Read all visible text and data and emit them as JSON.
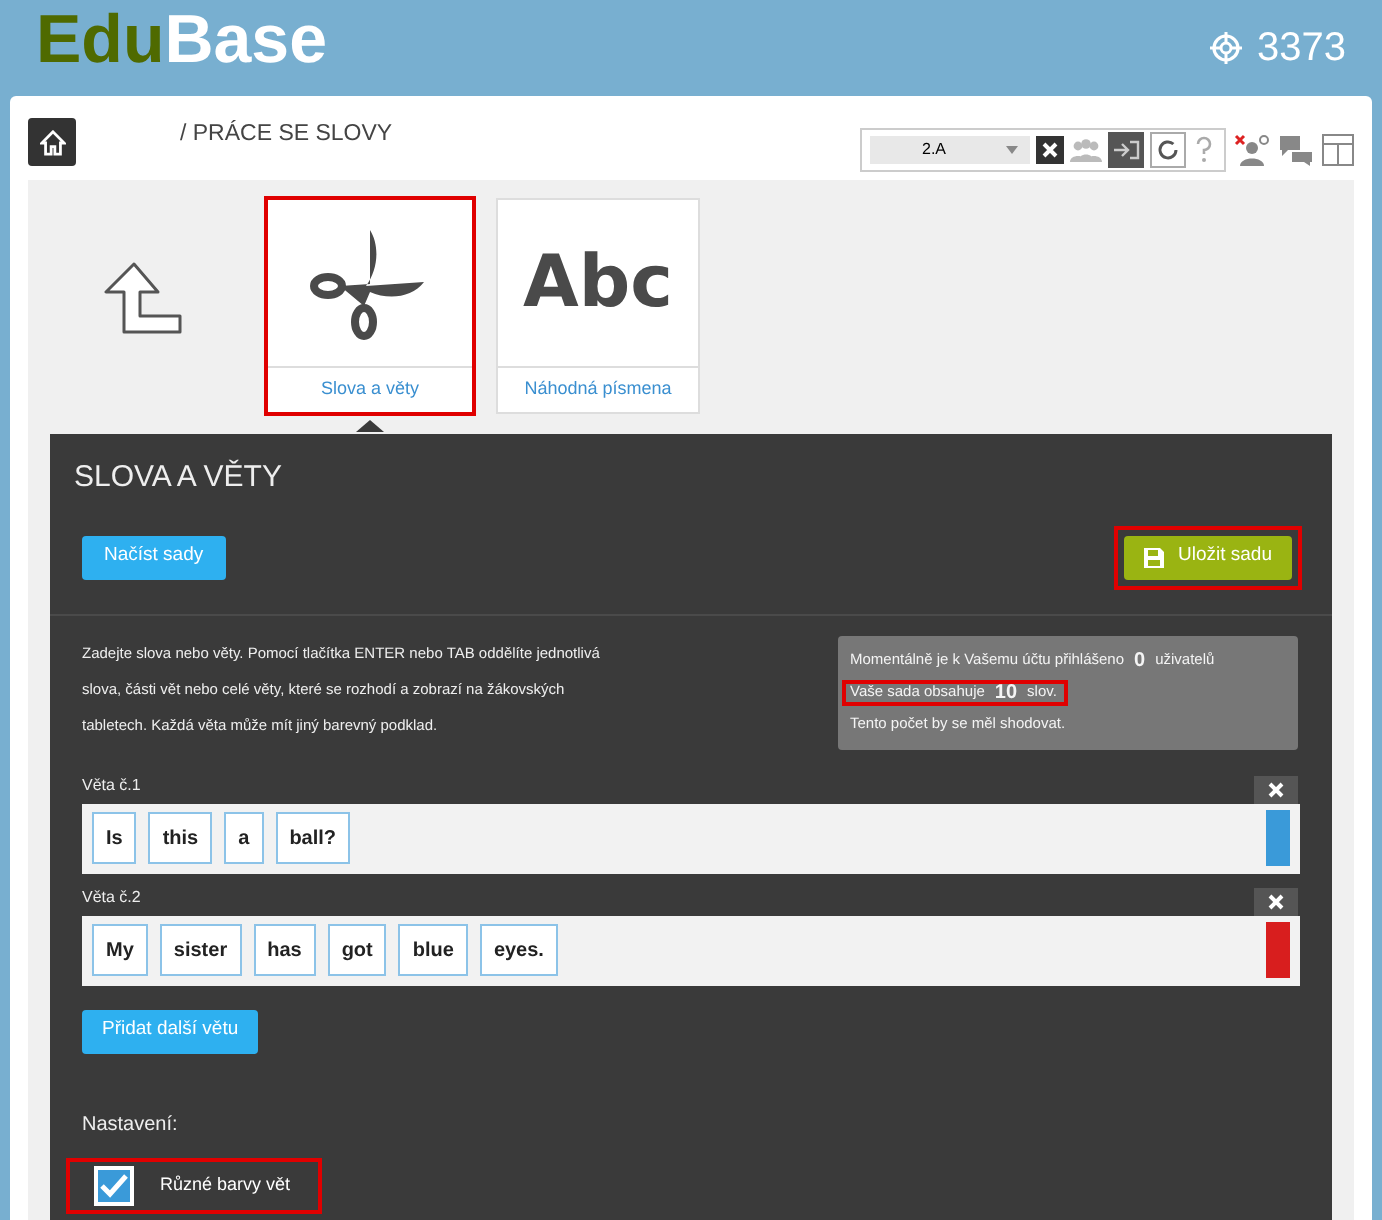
{
  "header": {
    "logo": [
      "Edu",
      "Base"
    ],
    "score": "3373"
  },
  "breadcrumb": "/ PRÁCE SE SLOVY",
  "toolbar": {
    "class_select": "2.A"
  },
  "tiles": [
    {
      "kind": "scissors",
      "label": "Slova a věty",
      "selected": true
    },
    {
      "kind": "abc",
      "glyph": "Abc",
      "label": "Náhodná písmena",
      "selected": false
    }
  ],
  "panel": {
    "title": "SLOVA A VĚTY",
    "load_button": "Načíst sady",
    "save_button": {
      "label": "Uložit sadu",
      "highlighted": true
    },
    "instructions": "Zadejte slova nebo věty. Pomocí tlačítka ENTER nebo TAB oddělíte jednotlivá slova, části vět nebo celé věty, které se rozhodí a zobrazí na žákovských tabletech. Každá věta může mít jiný barevný podklad.",
    "info": [
      {
        "before": "Momentálně je k Vašemu účtu přihlášeno",
        "count": "0",
        "after": "uživatelů",
        "highlighted": false
      },
      {
        "before": "Vaše sada obsahuje",
        "count": "10",
        "after": "slov.",
        "highlighted": true
      },
      {
        "before": "Tento počet by se měl shodovat.",
        "highlighted": false
      }
    ],
    "sentences": [
      {
        "label": "Věta č.1",
        "color": "#3a9ad9",
        "words": [
          "Is",
          "this",
          "a",
          "ball?"
        ]
      },
      {
        "label": "Věta č.2",
        "color": "#d81e1e",
        "words": [
          "My",
          "sister",
          "has",
          "got",
          "blue",
          "eyes."
        ]
      }
    ],
    "add_button": "Přidat další větu",
    "settings_label": "Nastavení:",
    "options": [
      {
        "label": "Různé barvy vět",
        "checked": true,
        "highlighted": true
      }
    ]
  }
}
